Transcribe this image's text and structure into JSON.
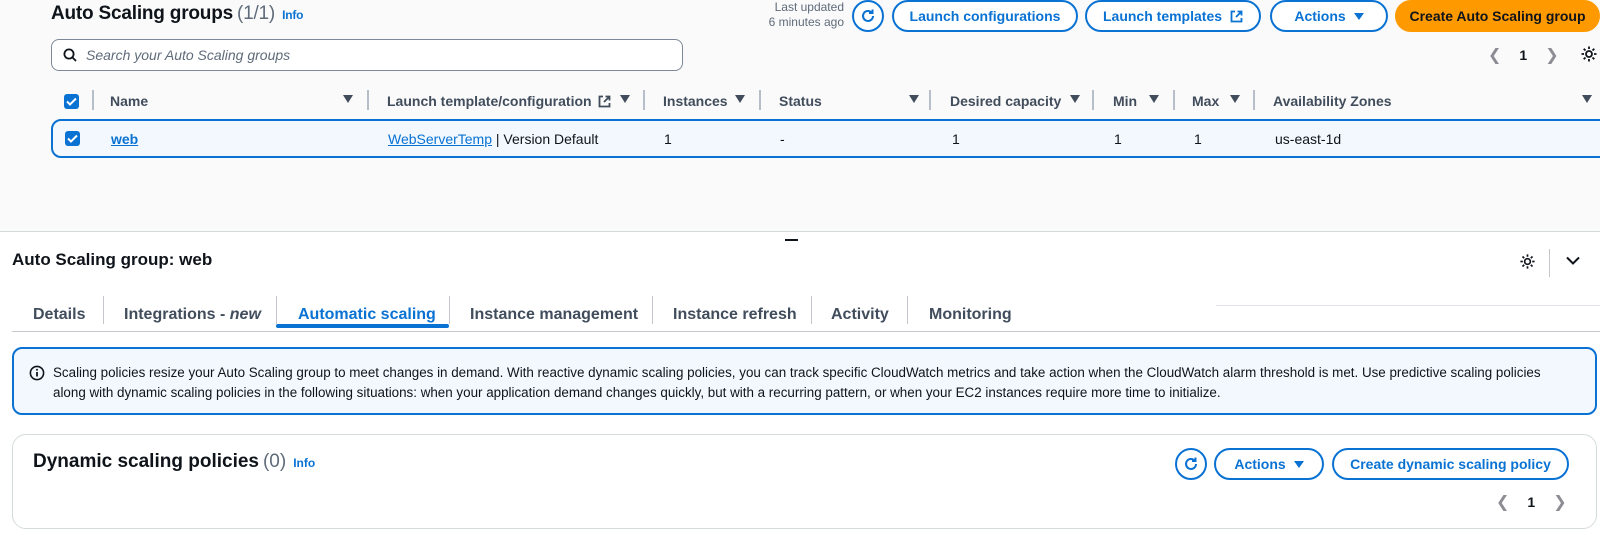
{
  "header": {
    "title": "Auto Scaling groups",
    "count": "(1/1)",
    "info": "Info",
    "updated_line1": "Last updated",
    "updated_line2": "6 minutes ago",
    "launch_configurations": "Launch configurations",
    "launch_templates": "Launch templates",
    "actions": "Actions",
    "create": "Create Auto Scaling group"
  },
  "search": {
    "placeholder": "Search your Auto Scaling groups"
  },
  "pagination": {
    "page": "1"
  },
  "table": {
    "columns": [
      "Name",
      "Launch template/configuration",
      "Instances",
      "Status",
      "Desired capacity",
      "Min",
      "Max",
      "Availability Zones"
    ],
    "rows": [
      {
        "name": "web",
        "template_link": "WebServerTemp",
        "template_rest": " | Version Default",
        "instances": "1",
        "status": "-",
        "desired": "1",
        "min": "1",
        "max": "1",
        "az": "us-east-1d"
      }
    ]
  },
  "detail": {
    "title": "Auto Scaling group: web",
    "tabs": [
      {
        "label": "Details"
      },
      {
        "label": "Integrations - ",
        "suffix": "new"
      },
      {
        "label": "Automatic scaling"
      },
      {
        "label": "Instance management"
      },
      {
        "label": "Instance refresh"
      },
      {
        "label": "Activity"
      },
      {
        "label": "Monitoring"
      }
    ],
    "active_tab": "Automatic scaling",
    "alert_text": "Scaling policies resize your Auto Scaling group to meet changes in demand. With reactive dynamic scaling policies, you can track specific CloudWatch metrics and take action when the CloudWatch alarm threshold is met. Use predictive scaling policies along with dynamic scaling policies in the following situations: when your application demand changes quickly, but with a recurring pattern, or when your EC2 instances require more time to initialize.",
    "policies": {
      "title": "Dynamic scaling policies",
      "count": "(0)",
      "info": "Info",
      "actions": "Actions",
      "create": "Create dynamic scaling policy",
      "page": "1"
    }
  },
  "colors": {
    "accent": "#0972d3",
    "primary": "#ff9900",
    "text": "#0f141a",
    "muted": "#5f6b7a"
  },
  "icons": [
    "refresh-icon",
    "external-link-icon",
    "search-icon",
    "gear-icon",
    "chevron-down-icon",
    "info-icon",
    "checkbox-icon",
    "sort-icon"
  ]
}
